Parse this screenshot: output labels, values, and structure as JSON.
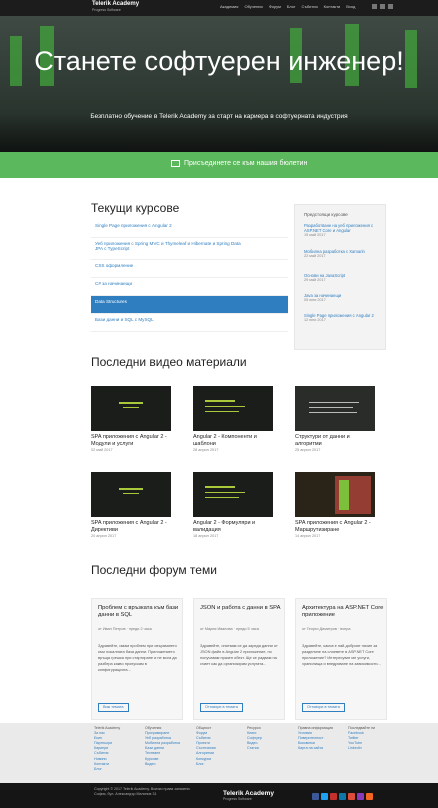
{
  "brand": {
    "name": "Telerik Academy",
    "tagline": "Progress Software"
  },
  "nav": {
    "items": [
      "Академия",
      "Обучения",
      "Форум",
      "Блог",
      "Събития",
      "Контакти",
      "Вход"
    ],
    "icons": [
      "facebook-icon",
      "twitter-icon",
      "youtube-icon"
    ]
  },
  "hero": {
    "title": "Станете софтуерен инженер!",
    "subtitle": "Безплатно обучение в Telerik Academy за старт на кариера в софтуерната индустрия"
  },
  "newsletter": {
    "label": "Присъединете се към нашия бюлетин"
  },
  "courses": {
    "heading": "Текущи курсове",
    "items": [
      {
        "label": "Single Page приложения с Angular 2",
        "active": false
      },
      {
        "label": "Уеб приложения с Spring MVC и Thymeleaf и Hibernate и Spring Data JPA с TypeScript",
        "active": false
      },
      {
        "label": "CSS оформление",
        "active": false
      },
      {
        "label": "C# за начинаещи",
        "active": false
      },
      {
        "label": "Data Structures",
        "active": true
      },
      {
        "label": "Бази данни и SQL с MySQL",
        "active": false
      }
    ]
  },
  "upcoming": {
    "heading": "Предстоящи курсове",
    "items": [
      {
        "label": "Разработване на уеб приложения с ASP.NET Core и Angular",
        "date": "15 май 2017"
      },
      {
        "label": "Мобилна разработка с Xamarin",
        "date": "22 май 2017"
      },
      {
        "label": "Основи на JavaScript",
        "date": "29 май 2017"
      },
      {
        "label": "Java за начинаещи",
        "date": "05 юни 2017"
      },
      {
        "label": "Single Page приложения с Angular 2",
        "date": "12 юни 2017"
      }
    ]
  },
  "videos": {
    "heading": "Последни видео материали",
    "items": [
      {
        "title": "SPA приложения с Angular 2 - Модули и услуги",
        "date": "02 май 2017"
      },
      {
        "title": "Angular 2 - Компоненти и шаблони",
        "date": "28 април 2017"
      },
      {
        "title": "Структури от данни и алгоритми",
        "date": "25 април 2017"
      },
      {
        "title": "SPA приложения с Angular 2 - Директиви",
        "date": "20 април 2017"
      },
      {
        "title": "Angular 2 - Формуляри и валидация",
        "date": "18 април 2017"
      },
      {
        "title": "SPA приложения с Angular 2 - Маршрутизиране",
        "date": "14 април 2017"
      }
    ]
  },
  "forum": {
    "heading": "Последни форум теми",
    "items": [
      {
        "title": "Проблем с връзката към бази данни в SQL",
        "meta": "от Иван Петров · преди 2 часа",
        "excerpt": "Здравейте, имам проблем при свързването към локалната база данни. Приложението връща грешка при стартиране и не мога да разбера какво пропускам в конфигурацията...",
        "button": "Виж темата"
      },
      {
        "title": "JSON и работа с данни в SPA",
        "meta": "от Мария Иванова · преди 5 часа",
        "excerpt": "Здравейте, опитвам се да заредя данни от JSON файл в Angular 2 приложение, но получавам празен обект. Ще се радвам на съвет как да организирам услугата...",
        "button": "Отговори в темата"
      },
      {
        "title": "Архитектура на ASP.NET Core приложение",
        "meta": "от Георги Димитров · вчера",
        "excerpt": "Здравейте, какъв е най-добрият начин за разделяне на слоевете в ASP.NET Core приложение? Интересуват ме услуги, хранилища и внедряване на зависимости...",
        "button": "Отговори в темата"
      }
    ]
  },
  "footer": {
    "columns": [
      [
        "Telerik Academy",
        "За нас",
        "Екип",
        "Партньори",
        "Кариери",
        "Събития",
        "Новини",
        "Контакти",
        "Блог"
      ],
      [
        "Обучения",
        "Програмиране",
        "Уеб разработка",
        "Мобилна разработка",
        "Бази данни",
        "Тестване",
        "Курсове",
        "Видео"
      ],
      [
        "Общност",
        "Форум",
        "Събития",
        "Проекти",
        "Състезания",
        "Алгоритми",
        "Конкурси",
        "Блог"
      ],
      [
        "Ресурси",
        "Книги",
        "Софтуер",
        "Видео",
        "Статии"
      ],
      [
        "Правна информация",
        "Условия",
        "Поверителност",
        "Бисквитки",
        "Карта на сайта"
      ],
      [
        "Последвайте ни",
        "Facebook",
        "Twitter",
        "YouTube",
        "LinkedIn"
      ]
    ]
  },
  "bottom": {
    "copyright": "Copyright © 2017 Telerik Academy. Всички права запазени.",
    "address": "София, бул. Александър Малинов 31",
    "logo": "Telerik Academy",
    "logo_sub": "Progress Software",
    "social": [
      "facebook-icon",
      "twitter-icon",
      "youtube-icon",
      "linkedin-icon",
      "google-plus-icon",
      "instagram-icon",
      "rss-icon"
    ]
  }
}
